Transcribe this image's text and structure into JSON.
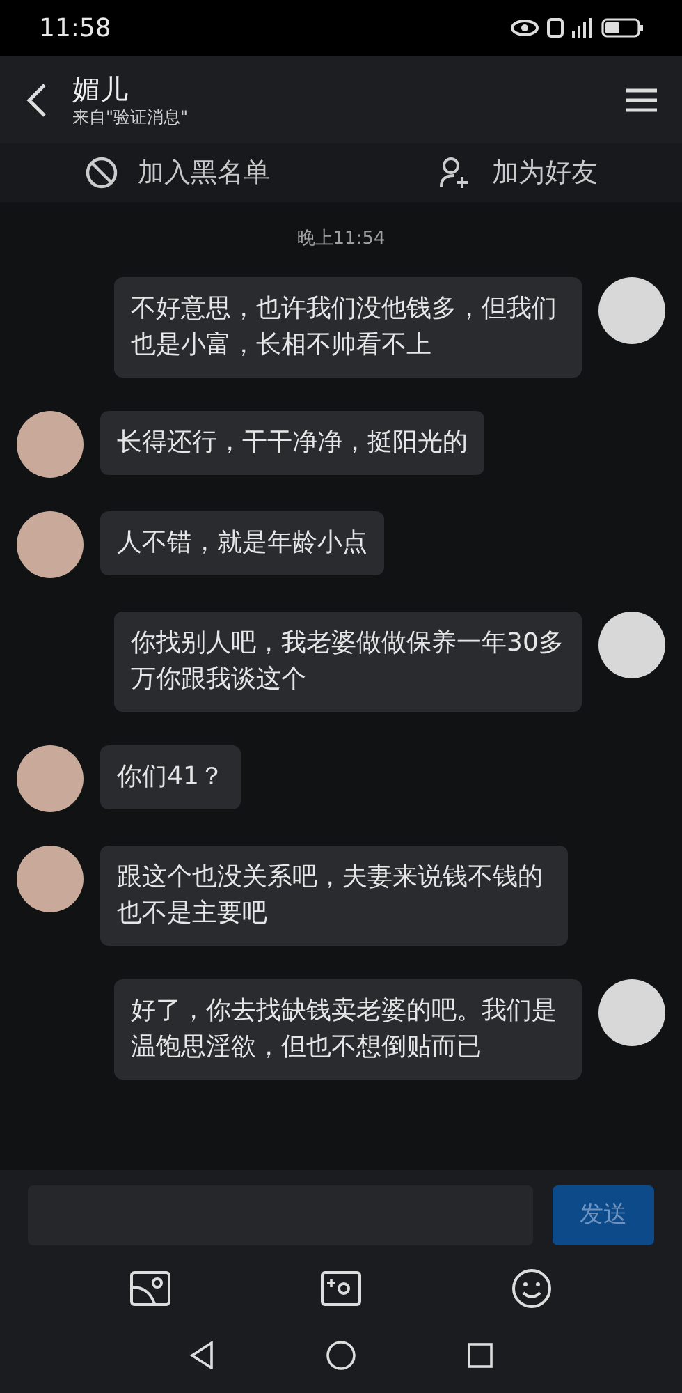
{
  "status_bar": {
    "time": "11:58"
  },
  "header": {
    "title": "媚儿",
    "subtitle": "来自\"验证消息\""
  },
  "actions": [
    {
      "kind": "block",
      "label": "加入黑名单"
    },
    {
      "kind": "add",
      "label": "加为好友"
    }
  ],
  "timestamp": "晚上11:54",
  "messages": [
    {
      "kind": "out",
      "text": "不好意思，也许我们没他钱多，但我们也是小富，长相不帅看不上"
    },
    {
      "kind": "in",
      "text": "长得还行，干干净净，挺阳光的"
    },
    {
      "kind": "in",
      "text": "人不错，就是年龄小点"
    },
    {
      "kind": "out",
      "text": "你找别人吧，我老婆做做保养一年30多万你跟我谈这个"
    },
    {
      "kind": "in",
      "text": "你们41？"
    },
    {
      "kind": "in",
      "text": "跟这个也没关系吧，夫妻来说钱不钱的也不是主要吧"
    },
    {
      "kind": "out",
      "text": "好了，你去找缺钱卖老婆的吧。我们是温饱思淫欲，但也不想倒贴而已"
    }
  ],
  "composer": {
    "send": "发送"
  }
}
